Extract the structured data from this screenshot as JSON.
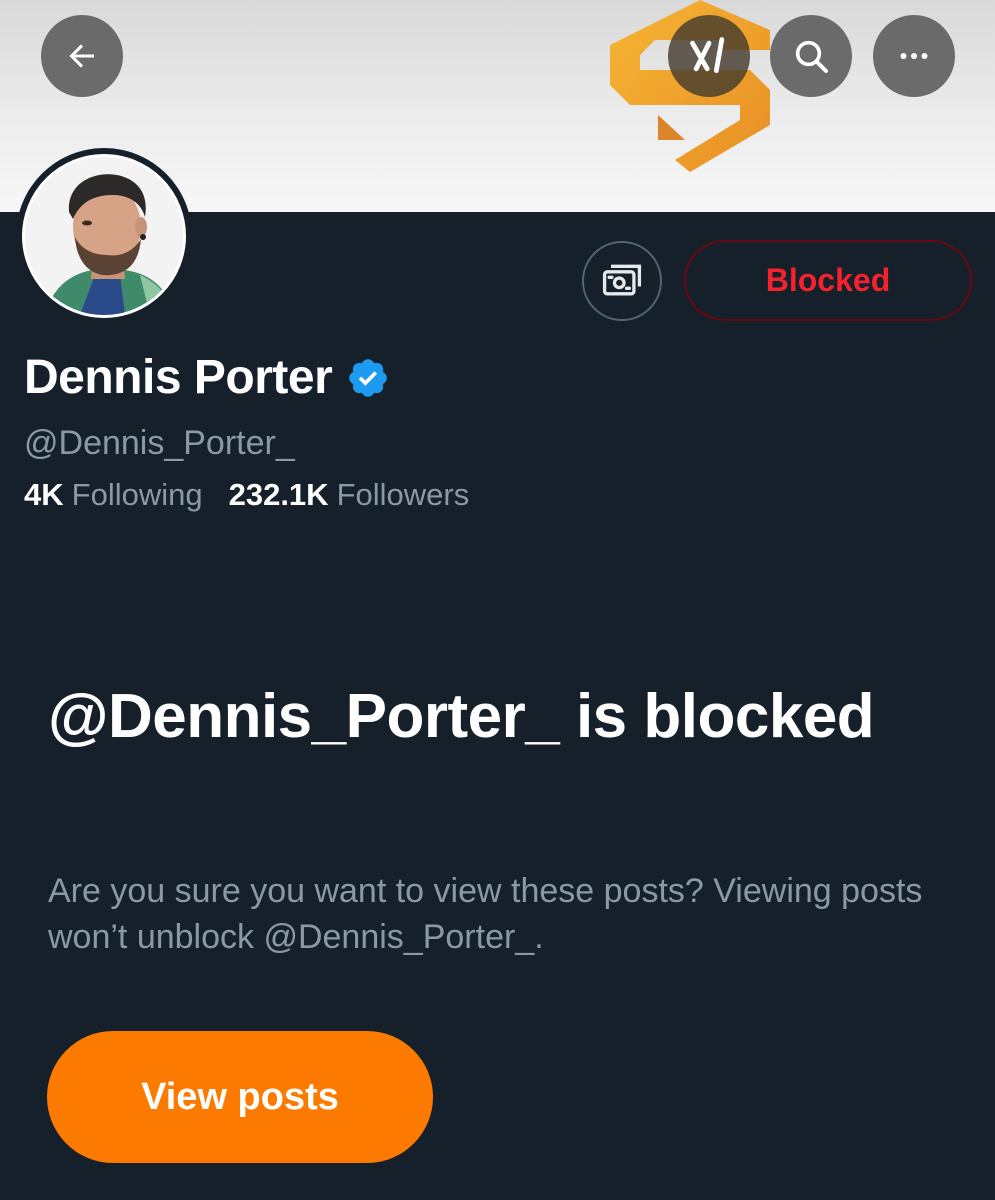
{
  "header": {
    "back_icon": "arrow-left-icon",
    "grok_icon": "grok-icon",
    "search_icon": "search-icon",
    "more_icon": "more-horizontal-icon"
  },
  "profile": {
    "display_name": "Dennis Porter",
    "handle": "@Dennis_Porter_",
    "verified": true,
    "verified_color": "#1d9bf0",
    "following_count": "4K",
    "following_label": "Following",
    "followers_count": "232.1K",
    "followers_label": "Followers"
  },
  "actions": {
    "tip_icon": "money-tip-icon",
    "blocked_label": "Blocked",
    "blocked_color": "#f4212e"
  },
  "blocked_notice": {
    "title": "@Dennis_Porter_ is blocked",
    "description": "Are you sure you want to view these posts? Viewing posts won’t unblock @Dennis_Porter_.",
    "view_posts_label": "View posts",
    "view_posts_color": "#fd7a00"
  },
  "colors": {
    "background": "#15202b",
    "secondary_text": "#8b98a5",
    "banner_logo_orange": "#f5a623"
  }
}
